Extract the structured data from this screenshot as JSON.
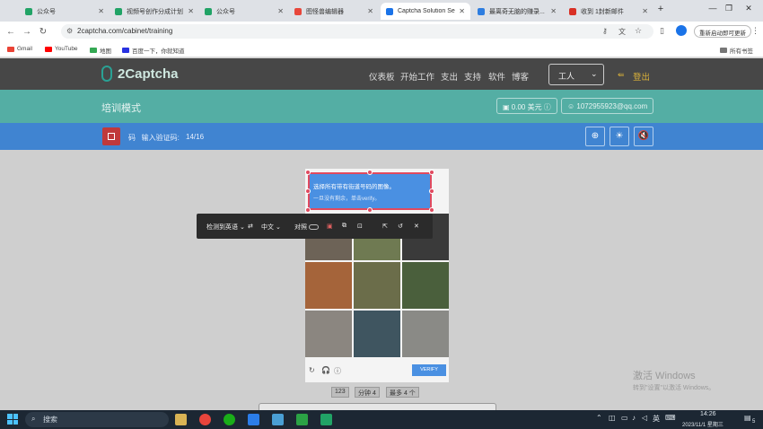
{
  "browser": {
    "tabs": [
      {
        "title": "公众号",
        "fav": "#21a366"
      },
      {
        "title": "视频号创作分成计划",
        "fav": "#21a366"
      },
      {
        "title": "公众号",
        "fav": "#21a366"
      },
      {
        "title": "图怪兽编辑器",
        "fav": "#e8473b"
      },
      {
        "title": "Captcha Solution Se",
        "fav": "#1a73e8"
      },
      {
        "title": "最离奇无脑的赚录...",
        "fav": "#2d7de0"
      },
      {
        "title": "收到 1封新邮件",
        "fav": "#d93025"
      }
    ],
    "new_tab": "+",
    "url": "2captcha.com/cabinet/training",
    "update_btn": "重新启动即可更新",
    "bookmarks": [
      "Gmail",
      "YouTube",
      "地图",
      "百度一下，你就知道"
    ],
    "all_bookmarks": "所有书签"
  },
  "site": {
    "logo": "2Captcha",
    "nav": [
      "仪表板",
      "开始工作",
      "支出",
      "支持",
      "软件",
      "博客"
    ],
    "worker_select": "工人",
    "logout": "登出",
    "page_title": "培训模式",
    "balance": "0.00 美元",
    "email": "1072955923@qq.com",
    "task_label": "码   输入验证码:",
    "progress": "14/16",
    "buttons": [
      "zoom-in-icon",
      "brightness-icon",
      "mute-icon"
    ]
  },
  "captcha": {
    "prompt": "选择所有带有街道号码的图像。",
    "sub": "一旦没有剩余，单击verify。",
    "tiles": [
      "#6d6357",
      "#6f7a52",
      "#3a3a3a",
      "#a5643a",
      "#6b6d4a",
      "#4a5f3c",
      "#8b8680",
      "#3f5560",
      "#8a8a86"
    ],
    "verify": "VERIFY"
  },
  "toolbar": {
    "detect": "检测到英语",
    "target": "中文",
    "compare": "对照"
  },
  "hints": {
    "b1": "123",
    "b2": "分钟 4",
    "b3": "最多 4 个"
  },
  "watermark": {
    "line1": "激活 Windows",
    "line2": "转到\"设置\"以激活 Windows。"
  },
  "taskbar": {
    "search": "搜索",
    "lang": "英",
    "time": "14:26",
    "date": "2023/11/1 星期三",
    "notify": "5"
  }
}
